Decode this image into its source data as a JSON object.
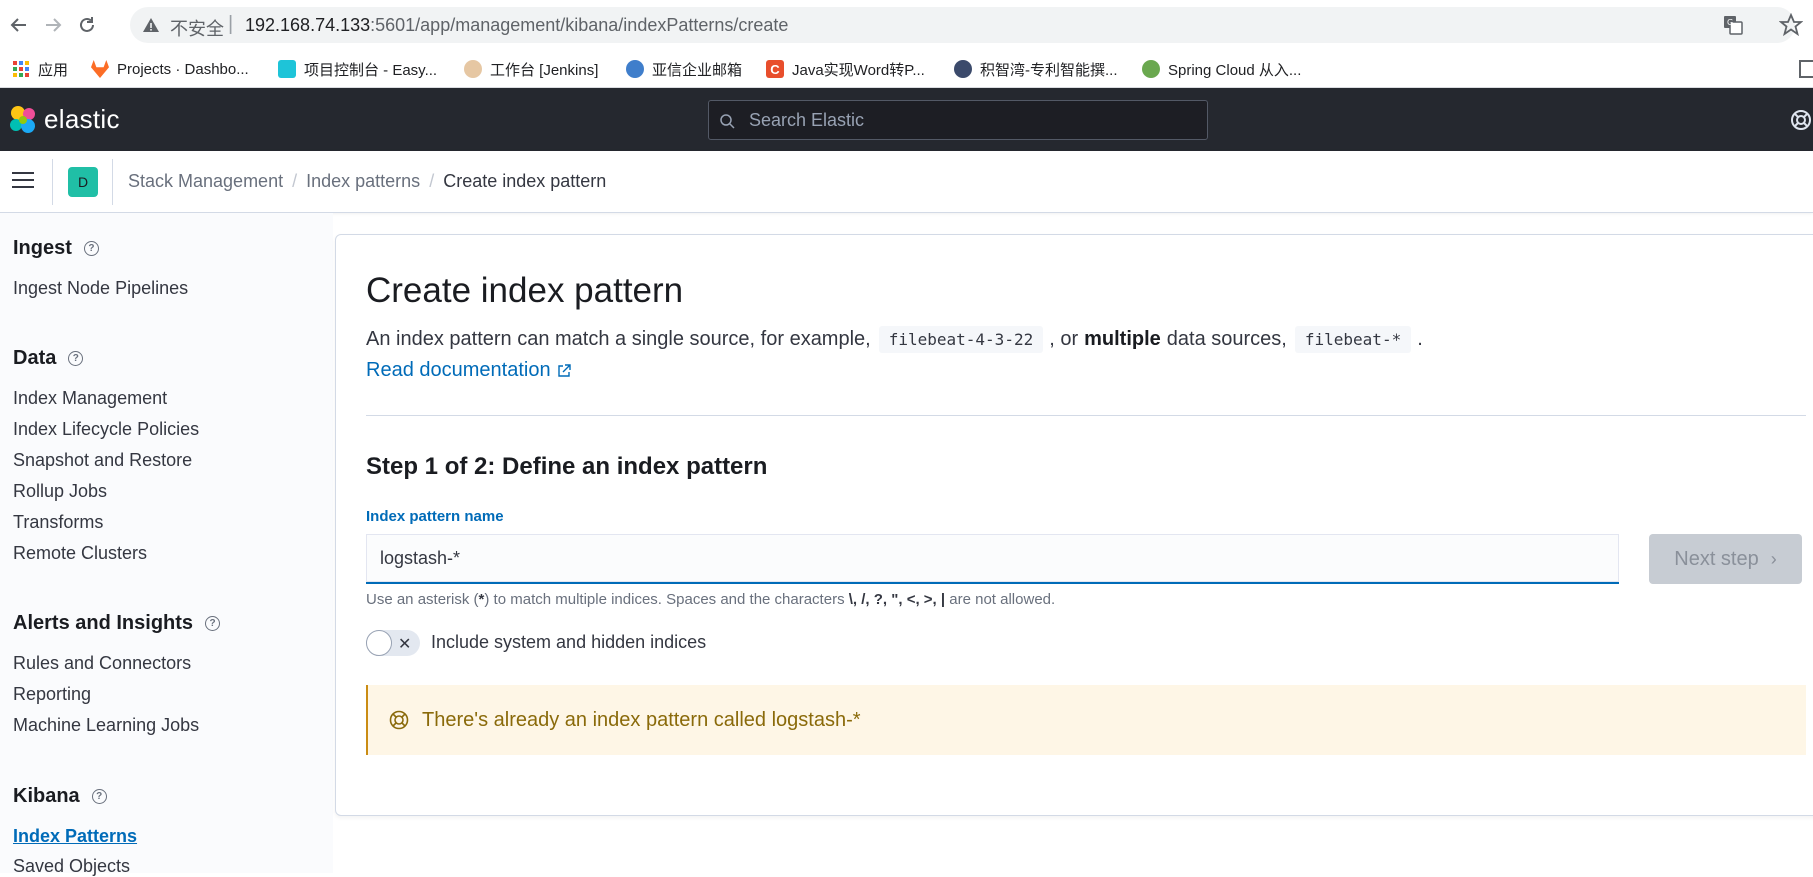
{
  "browser": {
    "insecure_label": "不安全",
    "url_host": "192.168.74.133",
    "url_path": ":5601/app/management/kibana/indexPatterns/create",
    "bookmarks": [
      {
        "label": "应用",
        "color": "#e8453c"
      },
      {
        "label": "Projects · Dashbo...",
        "color": "#fc6d26"
      },
      {
        "label": "项目控制台 - Easy...",
        "color": "#1ec4d8"
      },
      {
        "label": "工作台 [Jenkins]",
        "color": "#c98b52"
      },
      {
        "label": "亚信企业邮箱",
        "color": "#3f7ecb"
      },
      {
        "label": "Java实现Word转P...",
        "color": "#e84e2c"
      },
      {
        "label": "积智湾-专利智能撰...",
        "color": "#3b4a6b"
      },
      {
        "label": "Spring Cloud 从入...",
        "color": "#6aa84f"
      }
    ]
  },
  "header": {
    "logo_text": "elastic",
    "search_placeholder": "Search Elastic"
  },
  "subheader": {
    "space_initial": "D",
    "breadcrumbs": [
      "Stack Management",
      "Index patterns",
      "Create index pattern"
    ]
  },
  "sidebar": {
    "sections": [
      {
        "title": "Ingest",
        "items": [
          "Ingest Node Pipelines"
        ]
      },
      {
        "title": "Data",
        "items": [
          "Index Management",
          "Index Lifecycle Policies",
          "Snapshot and Restore",
          "Rollup Jobs",
          "Transforms",
          "Remote Clusters"
        ]
      },
      {
        "title": "Alerts and Insights",
        "items": [
          "Rules and Connectors",
          "Reporting",
          "Machine Learning Jobs"
        ]
      },
      {
        "title": "Kibana",
        "items": [
          "Index Patterns",
          "Saved Objects"
        ]
      }
    ]
  },
  "main": {
    "title": "Create index pattern",
    "desc_prefix": "An index pattern can match a single source, for example,",
    "desc_code1": "filebeat-4-3-22",
    "desc_mid1": ", or",
    "desc_bold": "multiple",
    "desc_mid2": "data sources,",
    "desc_code2": "filebeat-*",
    "desc_end": ".",
    "doc_link": "Read documentation",
    "step_title": "Step 1 of 2: Define an index pattern",
    "field_label": "Index pattern name",
    "field_value": "logstash-*",
    "next_button": "Next step",
    "help_prefix": "Use an asterisk (",
    "help_star": "*",
    "help_mid": ") to match multiple indices. Spaces and the characters",
    "help_chars": "\\, /, ?, \", <, >, |",
    "help_suffix": "are not allowed.",
    "toggle_label": "Include system and hidden indices",
    "callout_text": "There's already an index pattern called logstash-*"
  },
  "colors": {
    "header_bg": "#25282f",
    "link": "#006bb8",
    "space_avatar": "#20bfa6",
    "callout_bg": "#fef6e6",
    "callout_border": "#ca8c13"
  }
}
